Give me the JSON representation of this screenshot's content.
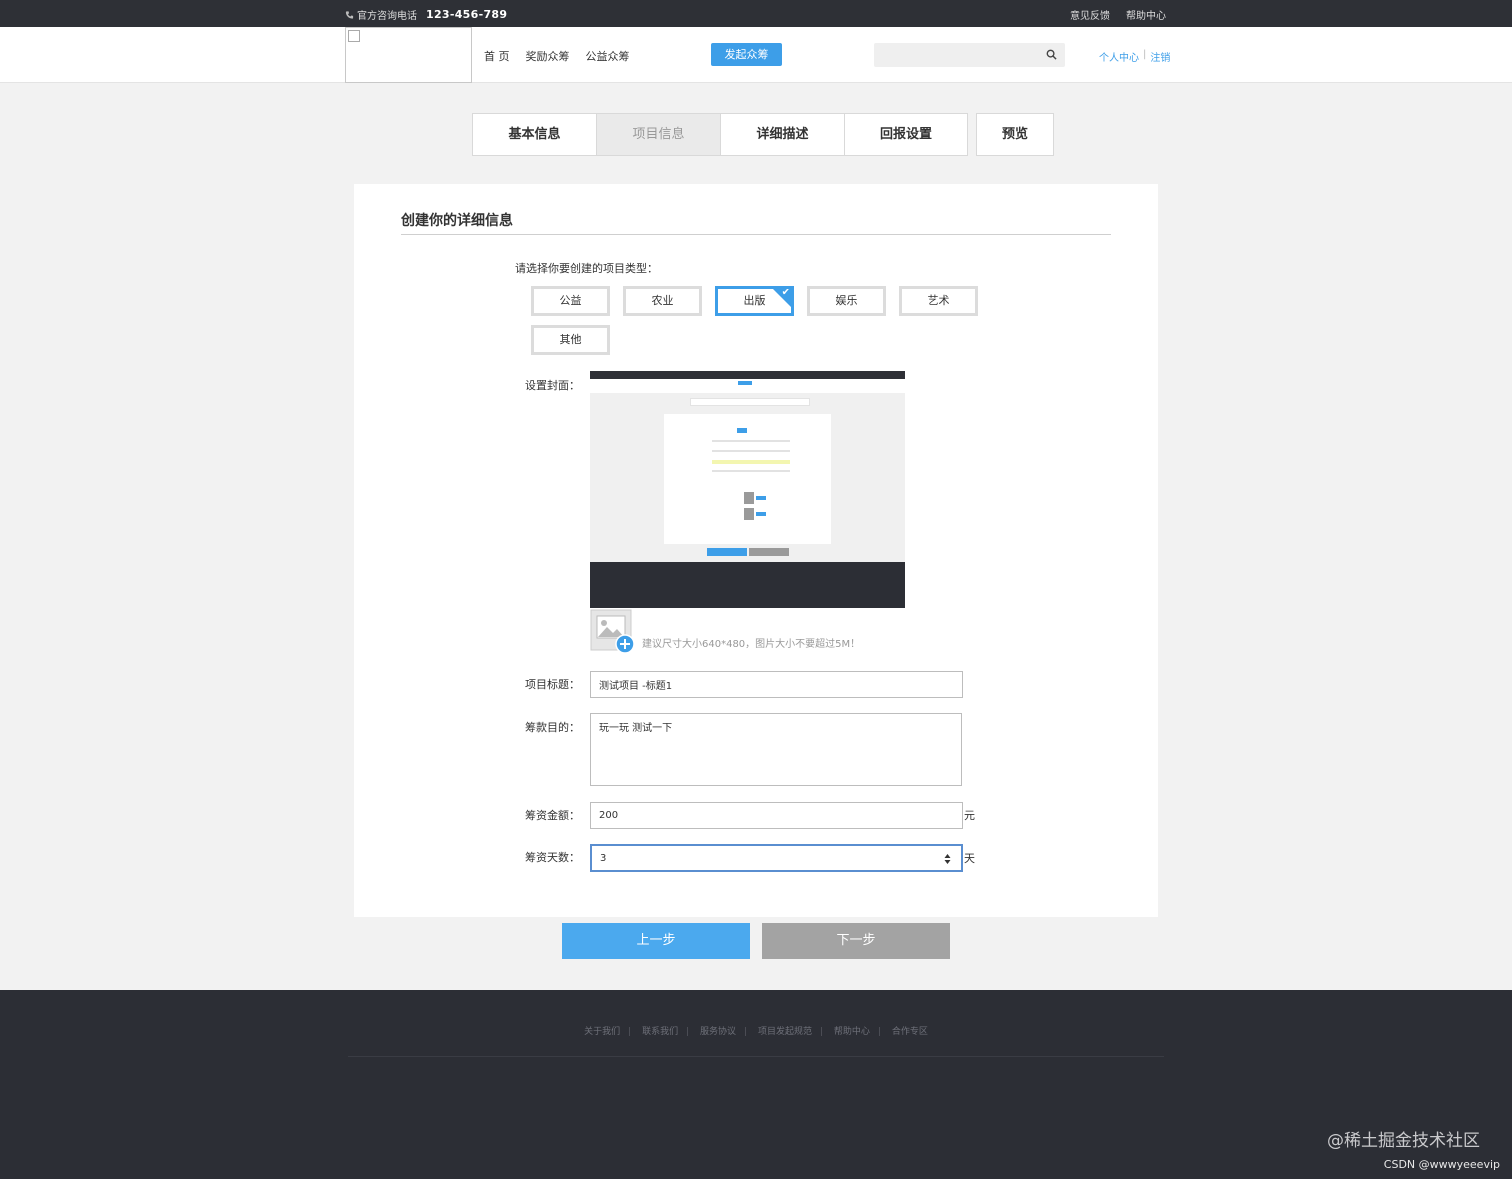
{
  "topbar": {
    "hotline_label": "官方咨询电话",
    "hotline_number": "123-456-789",
    "feedback": "意见反馈",
    "help": "帮助中心"
  },
  "header": {
    "nav": [
      "首 页",
      "奖励众筹",
      "公益众筹"
    ],
    "launch_button": "发起众筹",
    "search_placeholder": "",
    "user_center": "个人中心",
    "logout": "注销"
  },
  "steps": {
    "items": [
      {
        "label": "基本信息",
        "active": false
      },
      {
        "label": "项目信息",
        "active": true
      },
      {
        "label": "详细描述",
        "active": false
      },
      {
        "label": "回报设置",
        "active": false
      }
    ],
    "preview": "预览"
  },
  "form": {
    "title": "创建你的详细信息",
    "type_prompt": "请选择你要创建的项目类型：",
    "types": [
      "公益",
      "农业",
      "出版",
      "娱乐",
      "艺术",
      "其他"
    ],
    "selected_type": "出版",
    "cover_label": "设置封面：",
    "upload_hint": "建议尺寸大小640*480，图片大小不要超过5M！",
    "title_label": "项目标题：",
    "title_value": "测试项目 -标题1",
    "purpose_label": "筹款目的：",
    "purpose_value": "玩一玩 测试一下",
    "amount_label": "筹资金额：",
    "amount_value": "200",
    "amount_unit": "元",
    "days_label": "筹资天数：",
    "days_value": "3",
    "days_unit": "天"
  },
  "buttons": {
    "prev": "上一步",
    "next": "下一步"
  },
  "footer": {
    "links": [
      "关于我们",
      "联系我们",
      "服务协议",
      "项目发起规范",
      "帮助中心",
      "合作专区"
    ],
    "about_text": "",
    "copyright": ""
  },
  "watermark": {
    "site": "@稀土掘金技术社区",
    "author": "CSDN @wwwyeeevip"
  },
  "colors": {
    "accent": "#3d9ee8",
    "topbar": "#2e3036",
    "footer": "#2c2e35",
    "next_button": "#a3a3a3"
  }
}
